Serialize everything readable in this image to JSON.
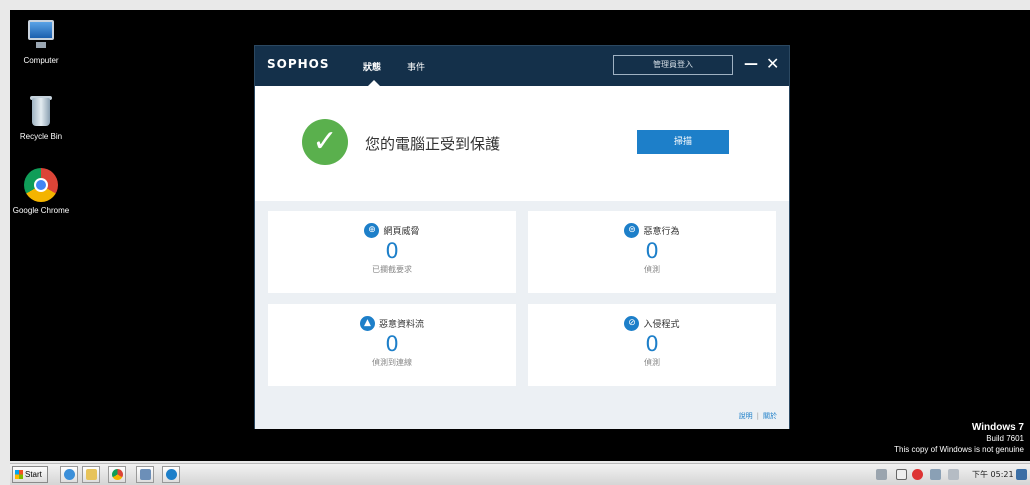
{
  "desktop": {
    "icons": [
      {
        "label": "Computer"
      },
      {
        "label": "Recycle Bin"
      },
      {
        "label": "Google Chrome"
      }
    ],
    "windows_notice": {
      "line1": "Windows 7",
      "line2": "Build 7601",
      "line3": "This copy of Windows is not genuine"
    }
  },
  "sophos": {
    "brand": "SOPHOS",
    "tabs": [
      {
        "label": "狀態",
        "active": true
      },
      {
        "label": "事件",
        "active": false
      }
    ],
    "admin_login_label": "管理員登入",
    "minimize_symbol": "—",
    "close_symbol": "✕",
    "status_text": "您的電腦正受到保護",
    "scan_label": "掃描",
    "cards": [
      {
        "title": "網頁威脅",
        "count": "0",
        "sub": "已攔截要求",
        "icon": "globe-icon"
      },
      {
        "title": "惡意行為",
        "count": "0",
        "sub": "偵測",
        "icon": "globe-icon"
      },
      {
        "title": "惡意資料流",
        "count": "0",
        "sub": "偵測到連線",
        "icon": "warning-icon"
      },
      {
        "title": "入侵程式",
        "count": "0",
        "sub": "偵測",
        "icon": "block-icon"
      }
    ],
    "footer": {
      "help": "說明",
      "about": "關於"
    }
  },
  "taskbar": {
    "start_label": "Start",
    "clock": "下午 05:21"
  },
  "colors": {
    "accent": "#1d7fc9",
    "titlebar": "#14304a",
    "success": "#5ab04d"
  }
}
